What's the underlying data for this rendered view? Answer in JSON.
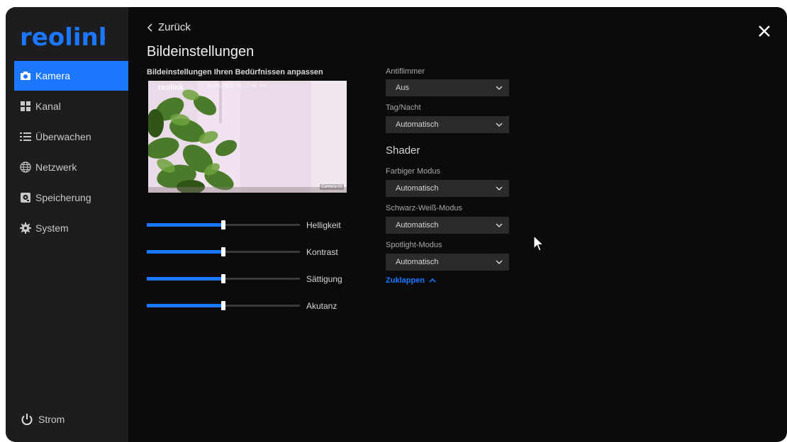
{
  "app": {
    "logo_text": "reolink"
  },
  "sidebar": {
    "items": [
      {
        "label": "Kamera",
        "icon": "camera-icon",
        "active": true
      },
      {
        "label": "Kanal",
        "icon": "grid-icon",
        "active": false
      },
      {
        "label": "Überwachen",
        "icon": "list-icon",
        "active": false
      },
      {
        "label": "Netzwerk",
        "icon": "globe-icon",
        "active": false
      },
      {
        "label": "Speicherung",
        "icon": "storage-icon",
        "active": false
      },
      {
        "label": "System",
        "icon": "gear-icon",
        "active": false
      }
    ],
    "power_label": "Strom"
  },
  "header": {
    "back_label": "Zurück",
    "title": "Bildeinstellungen",
    "subtitle": "Bildeinstellungen Ihren Bedürfnissen anpassen"
  },
  "preview": {
    "logo_text": "reolink",
    "timestamp": "05/01/2022 10:13:46 TUE",
    "camera_name": "Camera 01"
  },
  "sliders": [
    {
      "label": "Helligkeit",
      "value": 0.5
    },
    {
      "label": "Kontrast",
      "value": 0.5
    },
    {
      "label": "Sättigung",
      "value": 0.5
    },
    {
      "label": "Akutanz",
      "value": 0.5
    }
  ],
  "settings": {
    "antiflimmer": {
      "label": "Antiflimmer",
      "value": "Aus"
    },
    "tag_nacht": {
      "label": "Tag/Nacht",
      "value": "Automatisch"
    },
    "shader_heading": "Shader",
    "farbiger": {
      "label": "Farbiger Modus",
      "value": "Automatisch"
    },
    "schwarz_weiss": {
      "label": "Schwarz-Weiß-Modus",
      "value": "Automatisch"
    },
    "spotlight": {
      "label": "Spotlight-Modus",
      "value": "Automatisch"
    },
    "collapse_label": "Zuklappen"
  },
  "colors": {
    "accent": "#1c77ff",
    "background": "#0b0b0c",
    "sidebar": "#1d1d1f",
    "select": "#2b2b2d"
  }
}
